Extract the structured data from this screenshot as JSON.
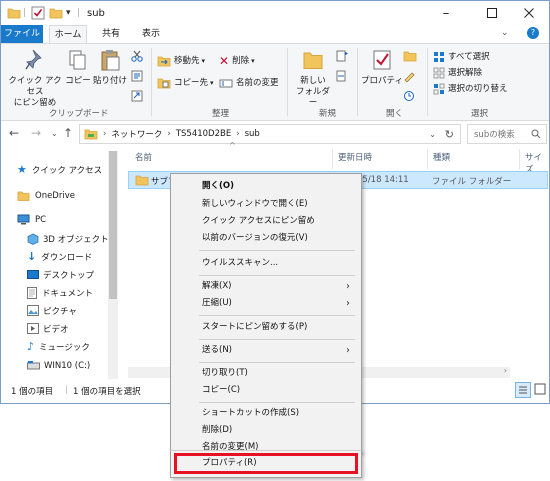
{
  "window": {
    "title": "sub"
  },
  "tabs": {
    "file": "ファイル",
    "home": "ホーム",
    "share": "共有",
    "view": "表示"
  },
  "ribbon": {
    "pin_quick": "クイック アクセス\nにピン留め",
    "copy": "コピー",
    "paste": "貼り付け",
    "clipboard_group": "クリップボード",
    "move_to": "移動先",
    "copy_to": "コピー先",
    "delete": "削除",
    "rename": "名前の変更",
    "organize_group": "整理",
    "new_folder": "新しい\nフォルダー",
    "new_group": "新規",
    "properties": "プロパティ",
    "open_group": "開く",
    "select_all": "すべて選択",
    "select_none": "選択解除",
    "invert_selection": "選択の切り替え",
    "select_group": "選択"
  },
  "address": {
    "crumbs": [
      "ネットワーク",
      "TS5410D2BE",
      "sub"
    ],
    "search_placeholder": "subの検索"
  },
  "navpane": {
    "items": [
      "クイック アクセス",
      "OneDrive",
      "PC",
      "3D オブジェクト",
      "ダウンロード",
      "デスクトップ",
      "ドキュメント",
      "ピクチャ",
      "ビデオ",
      "ミュージック",
      "WIN10 (C:)"
    ]
  },
  "filelist": {
    "columns": [
      "名前",
      "更新日時",
      "種類",
      "サイズ"
    ],
    "row": {
      "name": "サブフォ",
      "date": "05/18 14:11",
      "type": "ファイル フォルダー"
    }
  },
  "status": {
    "count": "1 個の項目",
    "selected": "1 個の項目を選択"
  },
  "context_menu": {
    "items": [
      "開く(O)",
      "新しいウィンドウで開く(E)",
      "クイック アクセスにピン留め",
      "以前のバージョンの復元(V)",
      "ウイルススキャン...",
      "解凍(X)",
      "圧縮(U)",
      "スタートにピン留めする(P)",
      "送る(N)",
      "切り取り(T)",
      "コピー(C)",
      "ショートカットの作成(S)",
      "削除(D)",
      "名前の変更(M)",
      "プロパティ(R)"
    ]
  },
  "colors": {
    "accent": "#1979ca",
    "selection": "#cce8ff",
    "highlight_box": "#e81123",
    "folder": "#f2c55c"
  }
}
